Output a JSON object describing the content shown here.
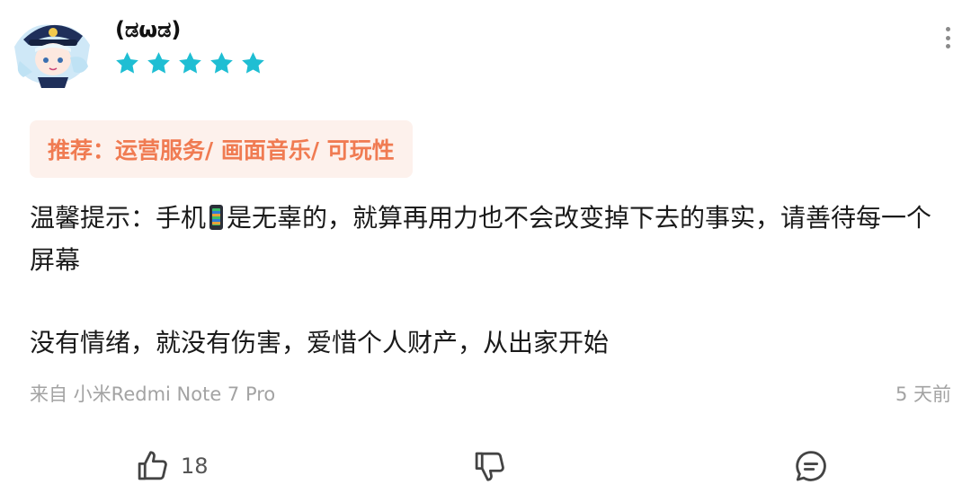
{
  "user": {
    "name": "(ಡωಡ)",
    "rating": 5,
    "avatar_icon": "avatar-anime-captain"
  },
  "menu_icon": "more-vertical-icon",
  "recommend": {
    "label": "推荐：",
    "value": "运营服务/ 画面音乐/ 可玩性"
  },
  "body": {
    "line1_before": "温馨提示：手机",
    "line1_after": "是无辜的，就算再用力也不会改变掉下去的事实，请善待每一个屏幕",
    "line2": "没有情绪，就没有伤害，爱惜个人财产，从出家开始"
  },
  "footer": {
    "source": "来自 小米Redmi Note 7 Pro",
    "time": "5 天前"
  },
  "actions": {
    "like_count": "18"
  },
  "colors": {
    "star": "#1fbed3",
    "accent": "#f07b52",
    "recommend_bg": "#fdf1ec",
    "muted": "#a3a3a3"
  }
}
